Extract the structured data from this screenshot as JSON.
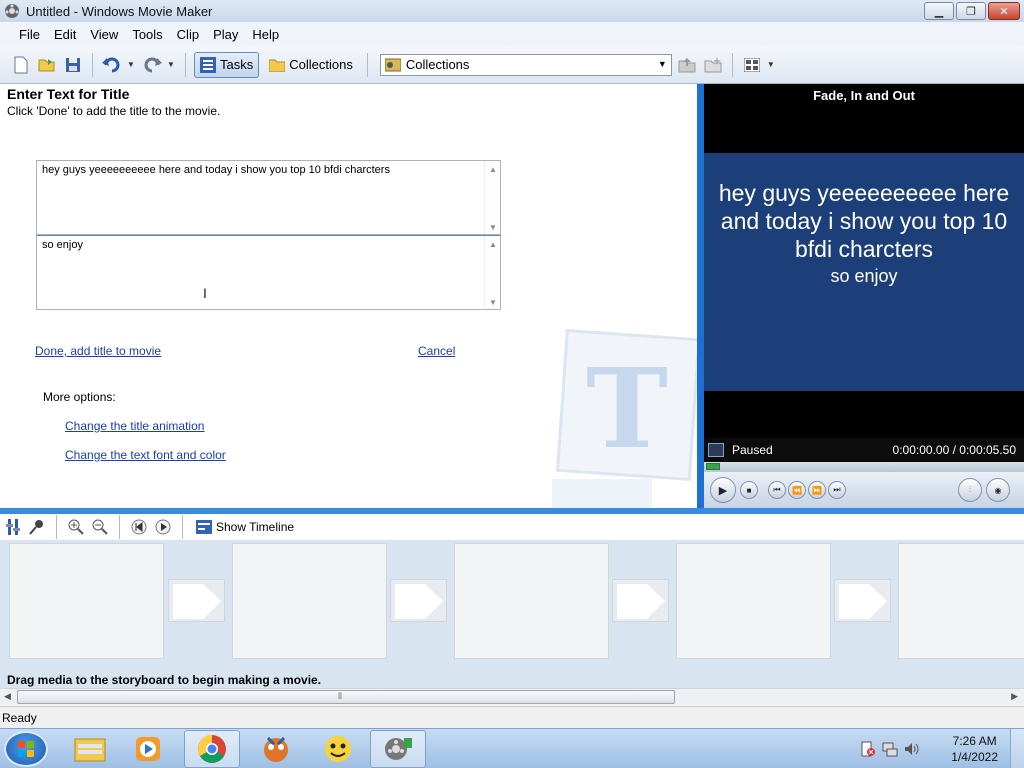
{
  "window": {
    "title": "Untitled - Windows Movie Maker"
  },
  "menu": [
    "File",
    "Edit",
    "View",
    "Tools",
    "Clip",
    "Play",
    "Help"
  ],
  "toolbar": {
    "tasks_label": "Tasks",
    "collections_label": "Collections",
    "collections_select_value": "Collections"
  },
  "task_pane": {
    "heading": "Enter Text for Title",
    "subtitle": "Click 'Done' to add the title to the movie.",
    "title_text_1": "hey guys yeeeeeeeeee here and today i show you top 10 bfdi charcters",
    "title_text_2": "so enjoy",
    "done_link": "Done, add title to movie",
    "cancel_link": "Cancel",
    "more_options_label": "More options:",
    "change_animation_link": "Change the title animation",
    "change_font_link": "Change the text font and color"
  },
  "preview": {
    "title": "Fade, In and Out",
    "line1": "hey guys yeeeeeeeeee here and today i show you top 10 bfdi charcters",
    "line2": "so enjoy",
    "status": "Paused",
    "time": "0:00:00.00 / 0:00:05.50",
    "progress_fraction": 0.0,
    "accent": "#1d6fd0"
  },
  "storyboard_toolbar": {
    "show_timeline_label": "Show Timeline"
  },
  "storyboard": {
    "hint": "Drag media to the storyboard to begin making a movie."
  },
  "status_bar": {
    "text": "Ready"
  },
  "taskbar": {
    "apps": [
      "explorer-icon",
      "media-player-icon",
      "chrome-icon",
      "game-icon",
      "character-icon",
      "movie-maker-icon"
    ],
    "time": "7:26 AM",
    "date": "1/4/2022"
  }
}
